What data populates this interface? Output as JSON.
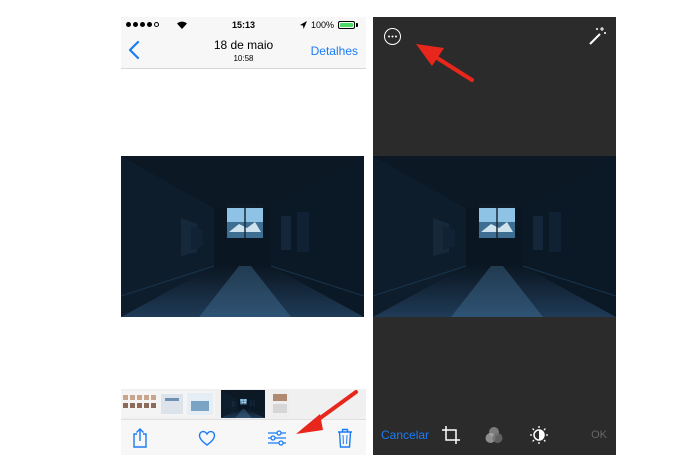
{
  "status_bar": {
    "time": "15:13",
    "battery_percent": "100%",
    "battery_color": "#4cd964"
  },
  "nav_bar": {
    "back_icon": "chevron-left-icon",
    "title": "18 de maio",
    "subtitle": "10:58",
    "details_label": "Detalhes"
  },
  "left_toolbar": {
    "icons": [
      "share-icon",
      "heart-icon",
      "adjustments-icon",
      "trash-icon"
    ]
  },
  "editor": {
    "more_icon": "more-options-icon",
    "auto_enhance_icon": "magic-wand-icon",
    "cancel_label": "Cancelar",
    "ok_label": "OK",
    "tools": [
      "crop-rotate-icon",
      "filters-icon",
      "light-adjust-icon"
    ]
  },
  "colors": {
    "accent": "#1a7cf5",
    "arrow": "#e8261c",
    "editor_background": "#2b2b2b"
  }
}
